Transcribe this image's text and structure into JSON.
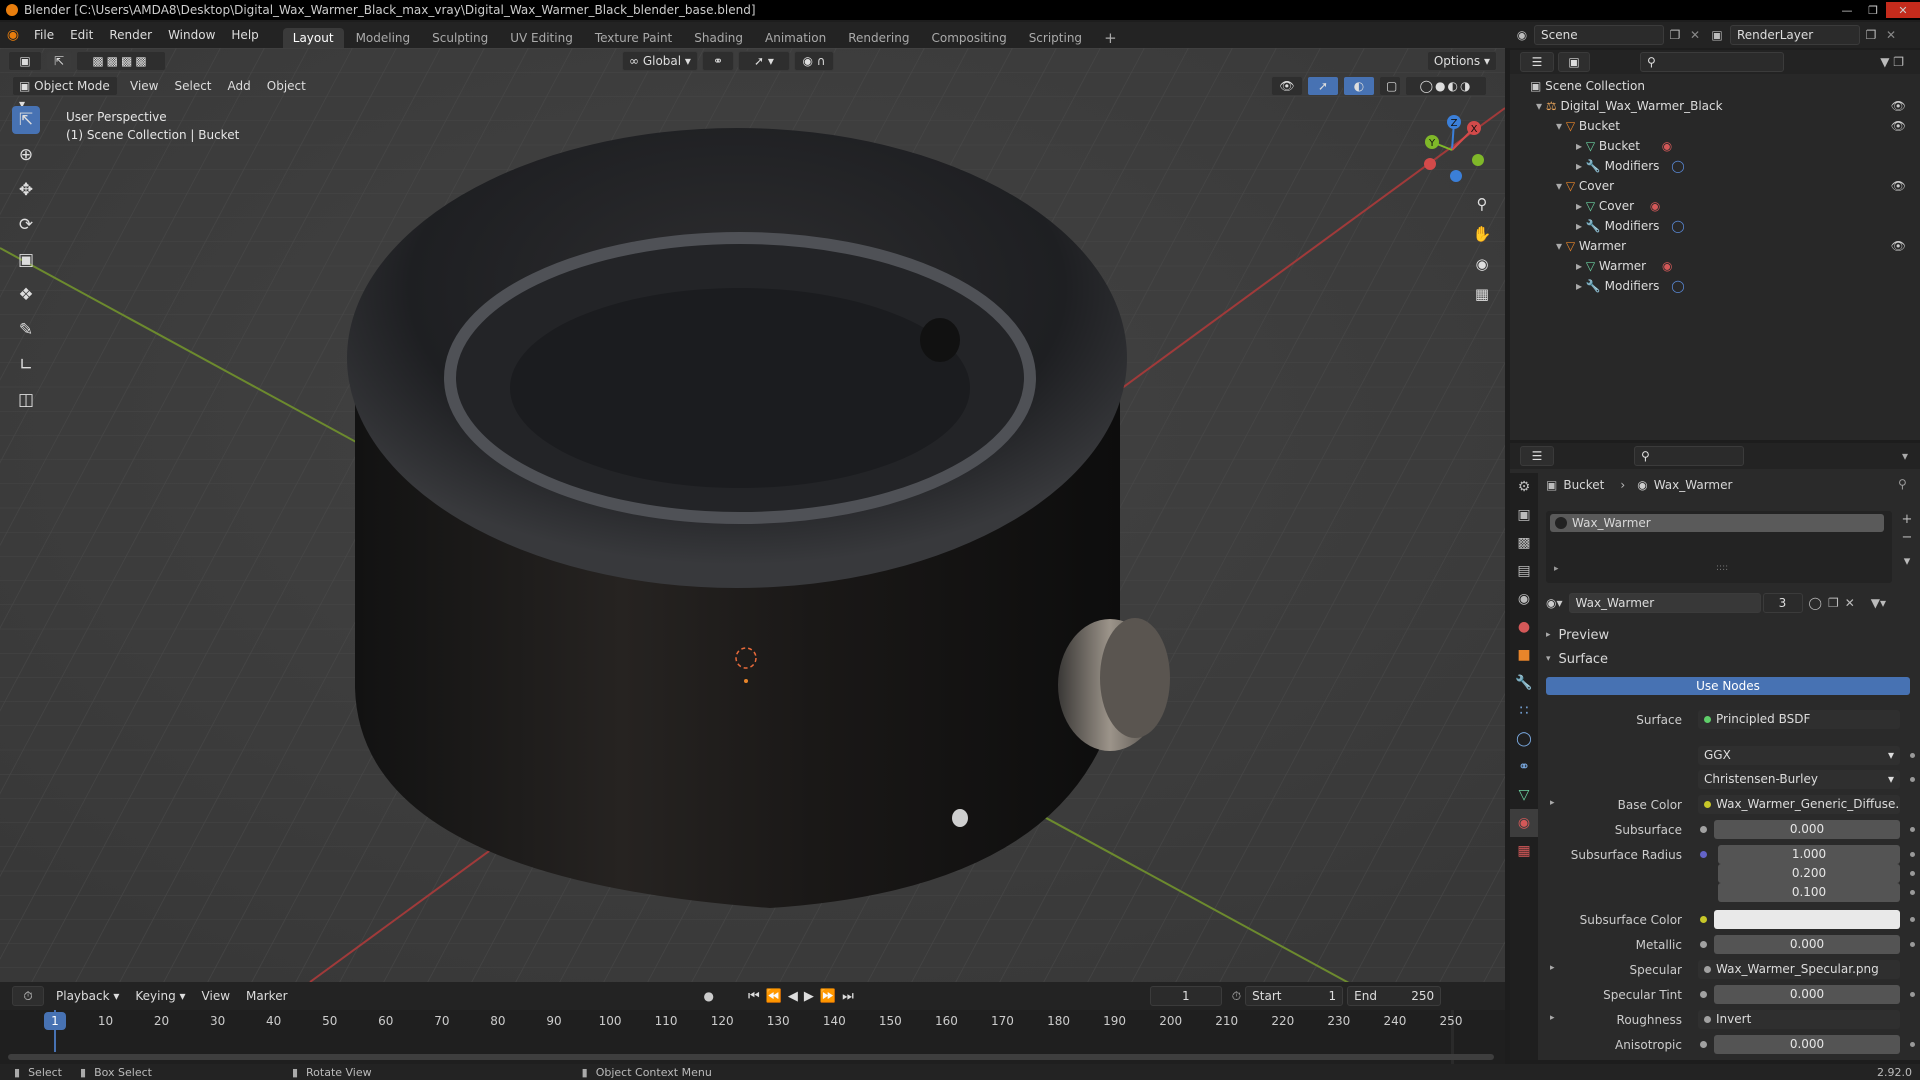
{
  "titlebar": {
    "text": "Blender [C:\\Users\\AMDA8\\Desktop\\Digital_Wax_Warmer_Black_max_vray\\Digital_Wax_Warmer_Black_blender_base.blend]"
  },
  "menus": [
    "File",
    "Edit",
    "Render",
    "Window",
    "Help"
  ],
  "workspaces": [
    {
      "label": "Layout",
      "active": true
    },
    {
      "label": "Modeling"
    },
    {
      "label": "Sculpting"
    },
    {
      "label": "UV Editing"
    },
    {
      "label": "Texture Paint"
    },
    {
      "label": "Shading"
    },
    {
      "label": "Animation"
    },
    {
      "label": "Rendering"
    },
    {
      "label": "Compositing"
    },
    {
      "label": "Scripting"
    }
  ],
  "scene": {
    "scene_name": "Scene",
    "render_layer": "RenderLayer"
  },
  "viewport": {
    "transform_orientation": "Global",
    "options_label": "Options",
    "mode": "Object Mode",
    "header_menus": [
      "View",
      "Select",
      "Add",
      "Object"
    ],
    "perspective": "User Perspective",
    "collection_info": "(1) Scene Collection | Bucket",
    "gizmo": {
      "x": "X",
      "y": "Y",
      "z": "Z"
    }
  },
  "outliner": {
    "root": "Scene Collection",
    "items": [
      {
        "label": "Digital_Wax_Warmer_Black",
        "indent": 1
      },
      {
        "label": "Bucket",
        "indent": 2
      },
      {
        "label": "Bucket",
        "indent": 3
      },
      {
        "label": "Modifiers",
        "indent": 3
      },
      {
        "label": "Cover",
        "indent": 2
      },
      {
        "label": "Cover",
        "indent": 3
      },
      {
        "label": "Modifiers",
        "indent": 3
      },
      {
        "label": "Warmer",
        "indent": 2
      },
      {
        "label": "Warmer",
        "indent": 3
      },
      {
        "label": "Modifiers",
        "indent": 3
      }
    ]
  },
  "properties": {
    "breadcrumb_object": "Bucket",
    "breadcrumb_material": "Wax_Warmer",
    "slot_material": "Wax_Warmer",
    "material_name": "Wax_Warmer",
    "user_count": "3",
    "preview_label": "Preview",
    "surface_label": "Surface",
    "use_nodes_label": "Use Nodes",
    "rows": {
      "surface": {
        "label": "Surface",
        "value": "Principled BSDF"
      },
      "distribution": {
        "value": "GGX"
      },
      "subsurface_method": {
        "value": "Christensen-Burley"
      },
      "base_color": {
        "label": "Base Color",
        "value": "Wax_Warmer_Generic_Diffuse.png"
      },
      "subsurface": {
        "label": "Subsurface",
        "value": "0.000"
      },
      "subsurface_radius": {
        "label": "Subsurface Radius",
        "values": [
          "1.000",
          "0.200",
          "0.100"
        ]
      },
      "subsurface_color": {
        "label": "Subsurface Color",
        "color": "#e9e9e9"
      },
      "metallic": {
        "label": "Metallic",
        "value": "0.000"
      },
      "specular": {
        "label": "Specular",
        "value": "Wax_Warmer_Specular.png"
      },
      "specular_tint": {
        "label": "Specular Tint",
        "value": "0.000"
      },
      "roughness": {
        "label": "Roughness",
        "value": "Invert"
      },
      "anisotropic": {
        "label": "Anisotropic",
        "value": "0.000"
      }
    }
  },
  "timeline": {
    "menus": [
      "Playback",
      "Keying",
      "View",
      "Marker"
    ],
    "current_frame": "1",
    "start_label": "Start",
    "start": "1",
    "end_label": "End",
    "end": "250",
    "ticks": [
      "1",
      "10",
      "20",
      "30",
      "40",
      "50",
      "60",
      "70",
      "80",
      "90",
      "100",
      "110",
      "120",
      "130",
      "140",
      "150",
      "160",
      "170",
      "180",
      "190",
      "200",
      "210",
      "220",
      "230",
      "240",
      "250"
    ]
  },
  "statusbar": {
    "select": "Select",
    "box_select": "Box Select",
    "rotate_view": "Rotate View",
    "context_menu": "Object Context Menu",
    "version": "2.92.0"
  },
  "colors": {
    "accent": "#4772b3",
    "orange": "#e87d0d",
    "x_axis": "#d34a4a",
    "y_axis": "#7fb829",
    "z_axis": "#3b7fd8"
  }
}
